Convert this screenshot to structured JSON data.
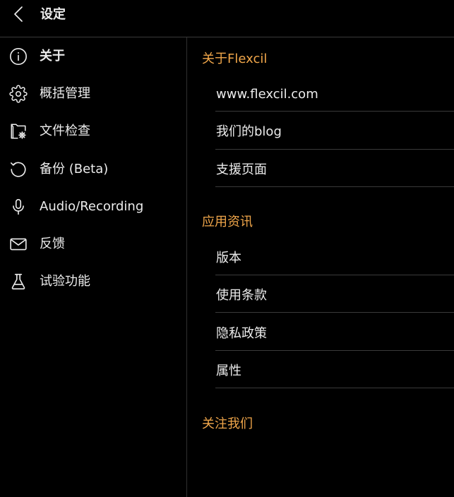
{
  "header": {
    "title": "设定",
    "back_icon": "chevron-left-icon"
  },
  "sidebar": {
    "items": [
      {
        "label": "关于",
        "icon": "info-icon",
        "selected": true
      },
      {
        "label": "概括管理",
        "icon": "gear-icon",
        "selected": false
      },
      {
        "label": "文件检查",
        "icon": "folder-gear-icon",
        "selected": false
      },
      {
        "label": "备份 (Beta)",
        "icon": "restore-icon",
        "selected": false
      },
      {
        "label": "Audio/Recording",
        "icon": "microphone-icon",
        "selected": false
      },
      {
        "label": "反馈",
        "icon": "envelope-icon",
        "selected": false
      },
      {
        "label": "试验功能",
        "icon": "flask-icon",
        "selected": false
      }
    ]
  },
  "content": {
    "sections": [
      {
        "title": "关于Flexcil",
        "rows": [
          {
            "label": "www.flexcil.com"
          },
          {
            "label": "我们的blog"
          },
          {
            "label": "支援页面"
          }
        ]
      },
      {
        "title": "应用资讯",
        "rows": [
          {
            "label": "版本"
          },
          {
            "label": "使用条款"
          },
          {
            "label": "隐私政策"
          },
          {
            "label": "属性"
          }
        ]
      },
      {
        "title": "关注我们"
      }
    ]
  },
  "colors": {
    "background": "#000000",
    "text": "#ececec",
    "accent": "#f0a64a",
    "divider": "#3a3a3a"
  }
}
